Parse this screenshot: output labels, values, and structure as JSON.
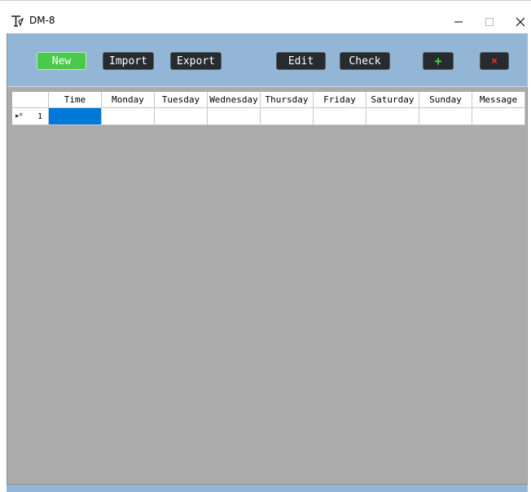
{
  "window": {
    "title": "DM-8",
    "icon": "stylized-t-app-icon"
  },
  "toolbar": {
    "buttons": [
      {
        "id": "new",
        "label": "New"
      },
      {
        "id": "import",
        "label": "Import"
      },
      {
        "id": "export",
        "label": "Export"
      },
      {
        "id": "edit",
        "label": "Edit"
      },
      {
        "id": "check",
        "label": "Check"
      },
      {
        "id": "add",
        "label": "+",
        "icon": "plus-icon"
      },
      {
        "id": "delete",
        "label": "×",
        "icon": "cross-icon"
      }
    ],
    "colors": {
      "background": "#93b6d6",
      "button": "#262b2f",
      "new_button": "#4cc84a",
      "add_icon": "#3ee03b",
      "delete_icon": "#ff2b2b"
    }
  },
  "grid": {
    "columns": [
      "Time",
      "Monday",
      "Tuesday",
      "Wednesday",
      "Thursday",
      "Friday",
      "Saturday",
      "Sunday",
      "Message"
    ],
    "rows": [
      {
        "number": "1",
        "marker": "▸*",
        "cells": [
          "",
          "",
          "",
          "",
          "",
          "",
          "",
          "",
          ""
        ]
      }
    ],
    "selected_color": "#0078d7",
    "empty_area_color": "#ababab"
  }
}
